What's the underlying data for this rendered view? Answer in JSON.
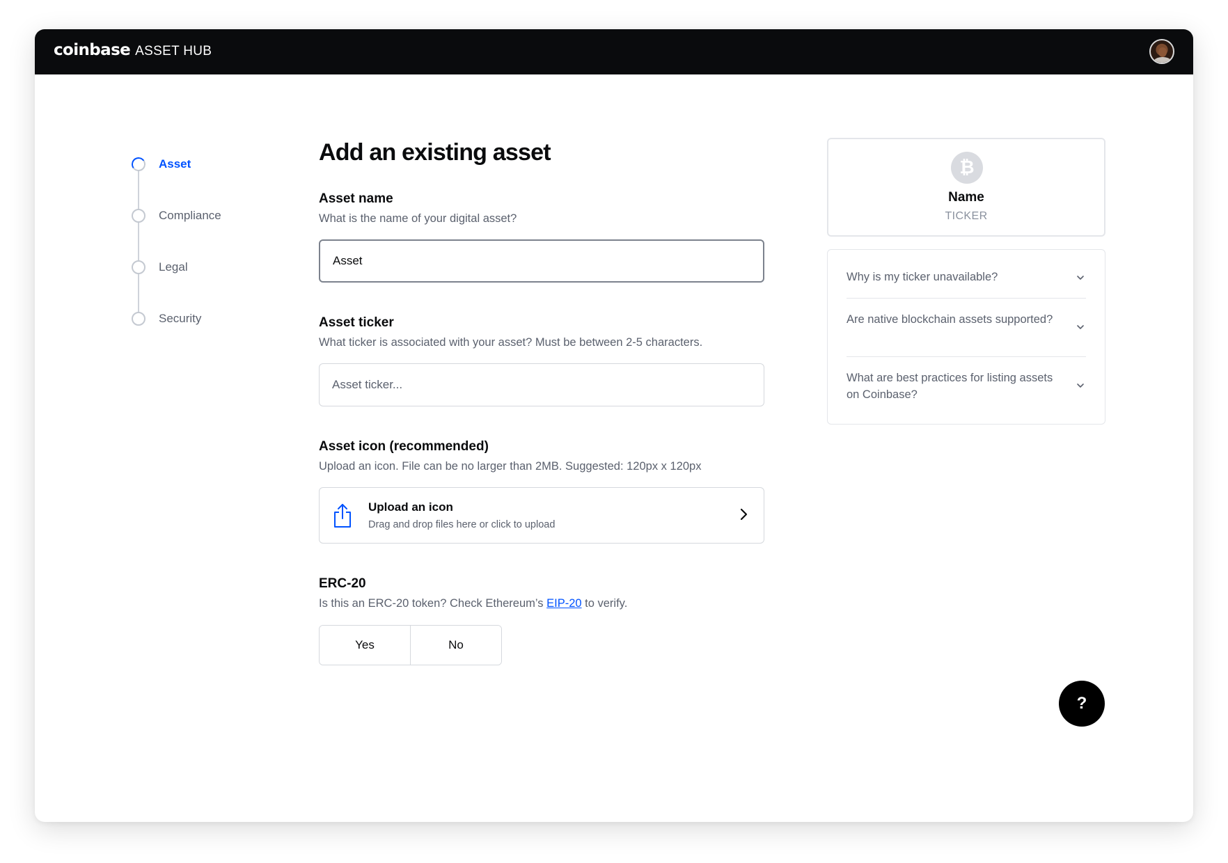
{
  "header": {
    "logo_text": "coinbase",
    "product_name": "ASSET HUB"
  },
  "stepper": {
    "steps": [
      {
        "label": "Asset",
        "active": true
      },
      {
        "label": "Compliance",
        "active": false
      },
      {
        "label": "Legal",
        "active": false
      },
      {
        "label": "Security",
        "active": false
      }
    ]
  },
  "form": {
    "title": "Add an existing asset",
    "asset_name": {
      "label": "Asset name",
      "description": "What is the name of your digital asset?",
      "value": "Asset"
    },
    "asset_ticker": {
      "label": "Asset ticker",
      "description": "What ticker is associated with your asset? Must be between 2-5 characters.",
      "placeholder": "Asset ticker..."
    },
    "asset_icon": {
      "label": "Asset icon (recommended)",
      "description": "Upload an icon. File can be no larger than 2MB. Suggested: 120px x 120px",
      "upload_title": "Upload an icon",
      "upload_subtitle": "Drag and drop files here or click to upload"
    },
    "erc20": {
      "label": "ERC-20",
      "description_before": "Is this an ERC-20 token? Check Ethereum’s ",
      "link_text": "EIP-20",
      "description_after": " to verify.",
      "yes_label": "Yes",
      "no_label": "No"
    }
  },
  "preview": {
    "coin_symbol": "₿",
    "name": "Name",
    "ticker": "TICKER"
  },
  "faq": {
    "items": [
      "Why is my ticker unavailable?",
      "Are native blockchain assets supported?",
      "What are best practices for listing assets on Coinbase?"
    ]
  },
  "help": {
    "label": "?"
  },
  "colors": {
    "header_bg": "#0a0b0d",
    "accent": "#0052ff",
    "muted_text": "#5b616e",
    "border": "#d5d8dd"
  },
  "icons": {
    "upload": "share-upload-icon",
    "chevron_right": "chevron-right-icon",
    "chevron_down": "chevron-down-icon",
    "coin": "bitcoin-icon"
  }
}
